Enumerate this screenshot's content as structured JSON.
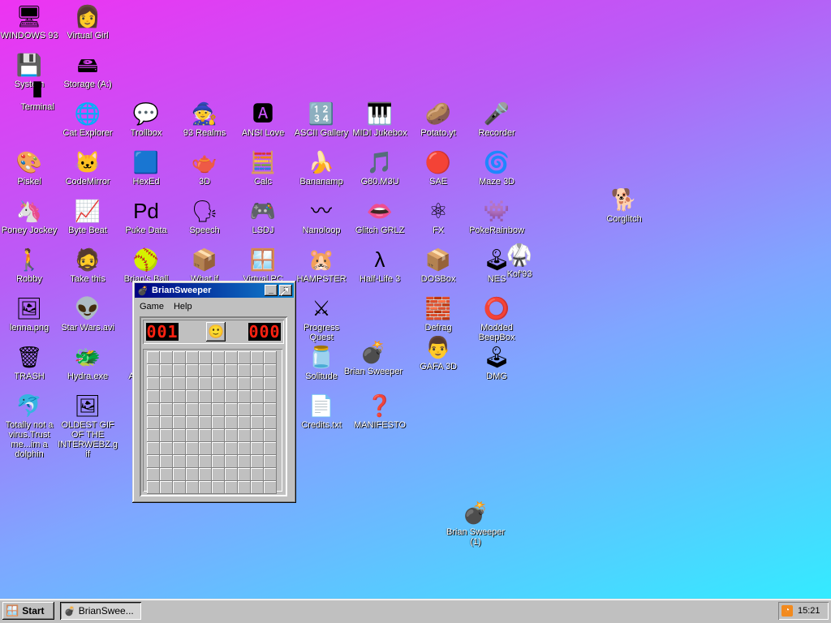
{
  "desktop": {
    "icons": [
      {
        "label": "WINDOWS 93",
        "glyph": "🖥",
        "icon": "computer-icon"
      },
      {
        "label": "Virtual Girl",
        "glyph": "👩",
        "icon": "virtual-girl-icon"
      },
      {
        "label": "System",
        "glyph": "💾",
        "icon": "system-icon"
      },
      {
        "label": "Storage (A:)",
        "glyph": "🖴",
        "icon": "floppy-drive-icon"
      },
      {
        "label": "Terminal",
        "glyph": "▮",
        "icon": "terminal-icon"
      },
      {
        "label": "Cat Explorer",
        "glyph": "🌐",
        "icon": "cat-explorer-icon"
      },
      {
        "label": "Trollbox",
        "glyph": "💬",
        "icon": "chat-icon"
      },
      {
        "label": "93 Realms",
        "glyph": "🧙",
        "icon": "realms-icon"
      },
      {
        "label": "ANSI Love",
        "glyph": "🅰",
        "icon": "ansi-icon"
      },
      {
        "label": "ASCII Gallery",
        "glyph": "🔢",
        "icon": "ascii-icon"
      },
      {
        "label": "MIDI Jukebox",
        "glyph": "🎹",
        "icon": "piano-icon"
      },
      {
        "label": "Potato.yt",
        "glyph": "🥔",
        "icon": "potato-icon"
      },
      {
        "label": "Recorder",
        "glyph": "🎤",
        "icon": "microphone-icon"
      },
      {
        "label": "Piskel",
        "glyph": "🎨",
        "icon": "palette-icon"
      },
      {
        "label": "CodeMirror",
        "glyph": "🐱",
        "icon": "codemirror-icon"
      },
      {
        "label": "HexEd",
        "glyph": "🟦",
        "icon": "cube-icon"
      },
      {
        "label": "3D",
        "glyph": "🫖",
        "icon": "teapot-icon"
      },
      {
        "label": "Calc",
        "glyph": "🧮",
        "icon": "calculator-icon"
      },
      {
        "label": "Bananamp",
        "glyph": "🍌",
        "icon": "banana-icon"
      },
      {
        "label": "G80.M3U",
        "glyph": "🎵",
        "icon": "playlist-icon"
      },
      {
        "label": "SAE",
        "glyph": "🔴",
        "icon": "ball-icon"
      },
      {
        "label": "Maze 3D",
        "glyph": "🌀",
        "icon": "maze-icon"
      },
      {
        "label": "Corglitch",
        "glyph": "🐕",
        "icon": "corgi-icon"
      },
      {
        "label": "Poney Jockey",
        "glyph": "🦄",
        "icon": "pony-icon"
      },
      {
        "label": "Byte Beat",
        "glyph": "📈",
        "icon": "bytebeat-icon"
      },
      {
        "label": "Puke Data",
        "glyph": "Pd",
        "icon": "puredata-icon"
      },
      {
        "label": "Speech",
        "glyph": "🗣",
        "icon": "speech-icon"
      },
      {
        "label": "LSDJ",
        "glyph": "🎮",
        "icon": "lsdj-icon"
      },
      {
        "label": "Nanoloop",
        "glyph": "〰",
        "icon": "wave-icon"
      },
      {
        "label": "Glitch GRLZ",
        "glyph": "👄",
        "icon": "lips-icon"
      },
      {
        "label": "FX",
        "glyph": "⚛",
        "icon": "atom-icon"
      },
      {
        "label": "PokeRainbow",
        "glyph": "👾",
        "icon": "pokerainbow-icon"
      },
      {
        "label": "Robby",
        "glyph": "🚶",
        "icon": "robot-icon"
      },
      {
        "label": "Take this",
        "glyph": "🧔",
        "icon": "face-icon"
      },
      {
        "label": "Brian's Ball",
        "glyph": "🥎",
        "icon": "ball2-icon"
      },
      {
        "label": "What if",
        "glyph": "📦",
        "icon": "crate-icon"
      },
      {
        "label": "Virtual PC",
        "glyph": "🪟",
        "icon": "virtualpc-icon"
      },
      {
        "label": "HAMPSTER",
        "glyph": "🐹",
        "icon": "hamster-icon"
      },
      {
        "label": "Half-Life 3",
        "glyph": "λ",
        "icon": "lambda-icon"
      },
      {
        "label": "DOSBox",
        "glyph": "📦",
        "icon": "dosbox-icon"
      },
      {
        "label": "NES",
        "glyph": "🕹",
        "icon": "nes-icon"
      },
      {
        "label": "Kof'93",
        "glyph": "🥋",
        "icon": "fighter-icon"
      },
      {
        "label": "lenna.png",
        "glyph": "🖼",
        "icon": "image-file-icon"
      },
      {
        "label": "Star Wars.avi",
        "glyph": "👽",
        "icon": "yoda-icon"
      },
      {
        "label": "Progress Quest",
        "glyph": "⚔",
        "icon": "swords-icon"
      },
      {
        "label": "Defrag",
        "glyph": "🧱",
        "icon": "defrag-icon"
      },
      {
        "label": "Modded BeepBox",
        "glyph": "⭕",
        "icon": "beepbox-icon"
      },
      {
        "label": "TRASH",
        "glyph": "🗑",
        "icon": "trash-icon"
      },
      {
        "label": "Hydra.exe",
        "glyph": "🐲",
        "icon": "hydra-icon"
      },
      {
        "label": "Acid Box",
        "glyph": "🎛",
        "icon": "acidbox-icon"
      },
      {
        "label": "Solitude",
        "glyph": "🫙",
        "icon": "solitude-icon"
      },
      {
        "label": "Brian Sweeper",
        "glyph": "💣",
        "icon": "mine-icon"
      },
      {
        "label": "GAFA 3D",
        "glyph": "👨",
        "icon": "doom-face-icon"
      },
      {
        "label": "DMG",
        "glyph": "🕹",
        "icon": "gameboy-icon"
      },
      {
        "label": "Totally not a virus.Trust me...im a dolphin",
        "glyph": "🐬",
        "icon": "dolphin-icon"
      },
      {
        "label": "OLDEST GIF OF THE INTERWEBZ.gif",
        "glyph": "🖼",
        "icon": "gif-file-icon"
      },
      {
        "label": "Credits.txt",
        "glyph": "📄",
        "icon": "text-file-icon"
      },
      {
        "label": "MANIFESTO",
        "glyph": "❓",
        "icon": "question-icon"
      },
      {
        "label": "Brian Sweeper (1)",
        "glyph": "💣",
        "icon": "mine-icon"
      }
    ]
  },
  "window": {
    "title": "BrianSweeper",
    "menu": [
      "Game",
      "Help"
    ],
    "mines_counter": "001",
    "timer": "000",
    "smiley": "🙂",
    "grid": {
      "cols": 10,
      "rows": 11
    }
  },
  "taskbar": {
    "start_label": "Start",
    "task_label": "BrianSwee...",
    "clock": "15:21"
  }
}
